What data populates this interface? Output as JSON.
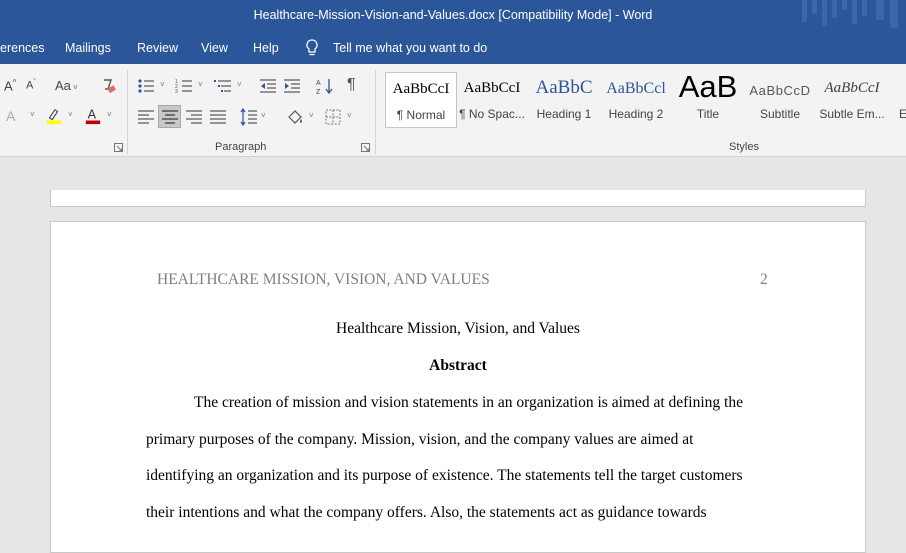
{
  "window": {
    "title": "Healthcare-Mission-Vision-and-Values.docx [Compatibility Mode]  -  Word"
  },
  "menu": [
    "erences",
    "Mailings",
    "Review",
    "View",
    "Help"
  ],
  "tell_me": "Tell me what you want to do",
  "ribbon": {
    "font_case_label": "Aa",
    "paragraph_label": "Paragraph",
    "styles_label": "Styles",
    "styles": [
      {
        "preview": "AaBbCcI",
        "label": "¶ Normal"
      },
      {
        "preview": "AaBbCcI",
        "label": "¶ No Spac..."
      },
      {
        "preview": "AaBbC",
        "label": "Heading 1"
      },
      {
        "preview": "AaBbCcl",
        "label": "Heading 2"
      },
      {
        "preview": "AaB",
        "label": "Title"
      },
      {
        "preview": "AaBbCcD",
        "label": "Subtitle"
      },
      {
        "preview": "AaBbCcI",
        "label": "Subtle Em..."
      },
      {
        "preview": "",
        "label": "E"
      }
    ],
    "colors": {
      "accent": "#2b579a",
      "highlight": "#ffff00",
      "font_color": "#c00000",
      "heading": "#2f5496"
    }
  },
  "document": {
    "header_text": "HEALTHCARE MISSION, VISION, AND VALUES",
    "page_number": "2",
    "title": "Healthcare Mission, Vision, and Values",
    "abstract_heading": "Abstract",
    "lines": [
      "The creation of mission and vision statements in an organization is aimed at defining the",
      "primary purposes of the company. Mission, vision, and the company values are aimed at",
      "identifying an organization and its purpose of existence. The statements tell the target customers",
      "their intentions and what the company offers. Also, the statements act as guidance towards"
    ]
  }
}
